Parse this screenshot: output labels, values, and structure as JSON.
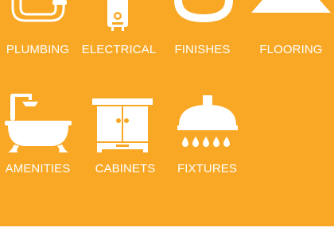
{
  "categories": [
    {
      "label": "PLUMBING",
      "icon": "pipe-icon"
    },
    {
      "label": "ELECTRICAL",
      "icon": "water-heater-icon"
    },
    {
      "label": "FINISHES",
      "icon": "sink-basin-icon"
    },
    {
      "label": "FLOORING",
      "icon": "flooring-icon"
    },
    {
      "label": "AMENITIES",
      "icon": "bathtub-icon"
    },
    {
      "label": "CABINETS",
      "icon": "cabinet-icon"
    },
    {
      "label": "FIXTURES",
      "icon": "shower-head-icon"
    }
  ],
  "colors": {
    "background": "#f9a825",
    "foreground": "#ffffff",
    "page": "#ffffff"
  }
}
